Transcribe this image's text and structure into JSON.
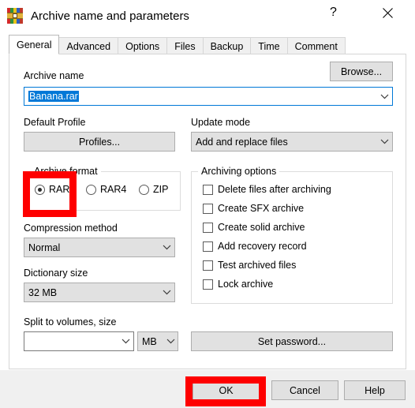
{
  "window": {
    "title": "Archive name and parameters",
    "icon": "winrar-books-icon",
    "help_caption": "?",
    "close_caption": "✕"
  },
  "tabs": [
    {
      "label": "General",
      "active": true
    },
    {
      "label": "Advanced",
      "active": false
    },
    {
      "label": "Options",
      "active": false
    },
    {
      "label": "Files",
      "active": false
    },
    {
      "label": "Backup",
      "active": false
    },
    {
      "label": "Time",
      "active": false
    },
    {
      "label": "Comment",
      "active": false
    }
  ],
  "general": {
    "archive_name_label": "Archive name",
    "archive_name_value": "Banana.rar",
    "browse_label": "Browse...",
    "default_profile_label": "Default Profile",
    "profiles_button": "Profiles...",
    "update_mode_label": "Update mode",
    "update_mode_value": "Add and replace files",
    "archive_format_label": "Archive format",
    "formats": [
      {
        "label": "RAR",
        "checked": true
      },
      {
        "label": "RAR4",
        "checked": false
      },
      {
        "label": "ZIP",
        "checked": false
      }
    ],
    "compression_method_label": "Compression method",
    "compression_method_value": "Normal",
    "dictionary_size_label": "Dictionary size",
    "dictionary_size_value": "32 MB",
    "split_label": "Split to volumes, size",
    "split_value": "",
    "split_unit_value": "MB",
    "set_password_button": "Set password...",
    "archiving_options_label": "Archiving options",
    "archiving_options": [
      {
        "label": "Delete files after archiving",
        "checked": false
      },
      {
        "label": "Create SFX archive",
        "checked": false
      },
      {
        "label": "Create solid archive",
        "checked": false
      },
      {
        "label": "Add recovery record",
        "checked": false
      },
      {
        "label": "Test archived files",
        "checked": false
      },
      {
        "label": "Lock archive",
        "checked": false
      }
    ]
  },
  "footer": {
    "ok_label": "OK",
    "cancel_label": "Cancel",
    "help_label": "Help"
  },
  "annotations": {
    "color": "#fe0000",
    "highlighted": [
      "rar-format-radio",
      "ok-button"
    ]
  }
}
